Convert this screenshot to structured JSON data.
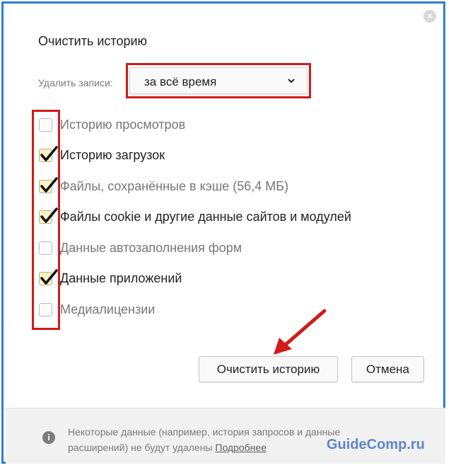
{
  "dialog": {
    "title": "Очистить историю",
    "close_symbol": "×"
  },
  "period": {
    "label": "Удалить записи:",
    "selected": "за всё время"
  },
  "options": [
    {
      "label": "Историю просмотров",
      "checked": false
    },
    {
      "label": "Историю загрузок",
      "checked": true
    },
    {
      "label": "Файлы, сохранённые в кэше (56,4 МБ)",
      "checked": true
    },
    {
      "label": "Файлы cookie и другие данные сайтов и модулей",
      "checked": true
    },
    {
      "label": "Данные автозаполнения форм",
      "checked": false
    },
    {
      "label": "Данные приложений",
      "checked": true
    },
    {
      "label": "Медиалицензии",
      "checked": false
    }
  ],
  "buttons": {
    "clear": "Очистить историю",
    "cancel": "Отмена"
  },
  "footer": {
    "info_symbol": "i",
    "text": "Некоторые данные (например, история запросов и данные расширений) не будут удалены",
    "link": "Подробнее"
  },
  "watermark": "GuideComp.ru",
  "colors": {
    "frame_border": "#2f7fd1",
    "highlight_red": "#d21a1a",
    "checked_fill": "#fbf2c6",
    "watermark_blue": "#5f86c9"
  },
  "icons": {
    "close": "close-icon",
    "chevron": "chevron-down-icon",
    "check": "checkmark-icon",
    "info": "info-icon",
    "arrow": "red-arrow-icon"
  }
}
